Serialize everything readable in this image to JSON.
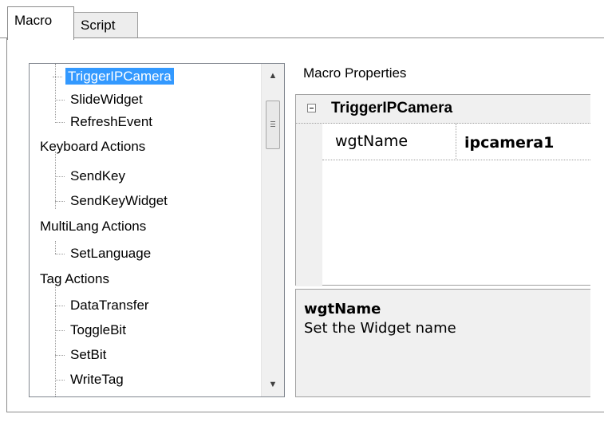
{
  "tabs": [
    {
      "label": "Macro",
      "active": true
    },
    {
      "label": "Script",
      "active": false
    }
  ],
  "tree": {
    "selected": "TriggerIPCamera",
    "items": [
      {
        "label": "TriggerIPCamera",
        "level": 1
      },
      {
        "label": "SlideWidget",
        "level": 1
      },
      {
        "label": "RefreshEvent",
        "level": 1
      },
      {
        "label": "Keyboard Actions",
        "level": 0
      },
      {
        "label": "SendKey",
        "level": 1
      },
      {
        "label": "SendKeyWidget",
        "level": 1
      },
      {
        "label": "MultiLang Actions",
        "level": 0
      },
      {
        "label": "SetLanguage",
        "level": 1
      },
      {
        "label": "Tag Actions",
        "level": 0
      },
      {
        "label": "DataTransfer",
        "level": 1
      },
      {
        "label": "ToggleBit",
        "level": 1
      },
      {
        "label": "SetBit",
        "level": 1
      },
      {
        "label": "WriteTag",
        "level": 1
      }
    ]
  },
  "properties": {
    "title": "Macro Properties",
    "category": "TriggerIPCamera",
    "rows": [
      {
        "name": "wgtName",
        "value": "ipcamera1"
      }
    ],
    "description": {
      "title": "wgtName",
      "text": "Set the Widget name"
    }
  },
  "colors": {
    "selection": "#3399ff",
    "panel_gray": "#f0f0f0"
  },
  "icons": {
    "scroll_up": "scroll-up-arrow-icon",
    "scroll_down": "scroll-down-arrow-icon",
    "collapse": "collapse-minus-icon"
  }
}
